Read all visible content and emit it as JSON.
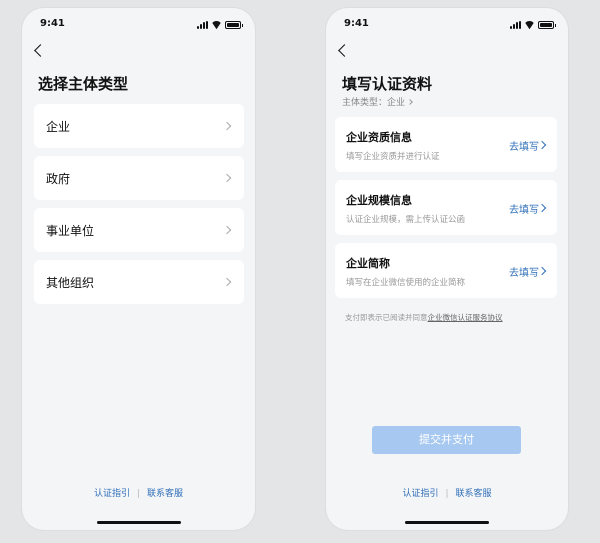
{
  "left_screen": {
    "status_time": "9:41",
    "title": "选择主体类型",
    "types": [
      {
        "label": "企业"
      },
      {
        "label": "政府"
      },
      {
        "label": "事业单位"
      },
      {
        "label": "其他组织"
      }
    ],
    "footer": {
      "guide": "认证指引",
      "separator": "|",
      "support": "联系客服"
    }
  },
  "right_screen": {
    "status_time": "9:41",
    "title": "填写认证资料",
    "subtitle_label": "主体类型：",
    "subtitle_value": "企业",
    "cards": [
      {
        "title": "企业资质信息",
        "desc": "填写企业资质并进行认证",
        "action": "去填写"
      },
      {
        "title": "企业规模信息",
        "desc": "认证企业规模，需上传认证公函",
        "action": "去填写"
      },
      {
        "title": "企业简称",
        "desc": "填写在企业微信使用的企业简称",
        "action": "去填写"
      }
    ],
    "agreement_prefix": "支付即表示已阅读并同意",
    "agreement_link": "企业微信认证服务协议",
    "submit_label": "提交并支付",
    "footer": {
      "guide": "认证指引",
      "separator": "|",
      "support": "联系客服"
    }
  },
  "colors": {
    "accent": "#2f6fb8",
    "button_disabled": "#a7c8f0",
    "background": "#f4f5f7"
  }
}
